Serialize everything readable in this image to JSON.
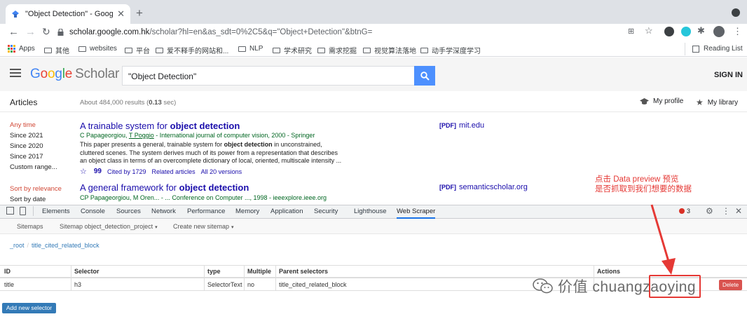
{
  "browser": {
    "tab_title": "\"Object Detection\" - Google Sc",
    "new_tab": "+",
    "url_host": "scholar.google.com.hk",
    "url_path": "/scholar?hl=en&as_sdt=0%2C5&q=\"Object+Detection\"&btnG=",
    "bookmarks": [
      "Apps",
      "其他",
      "websites",
      "平台",
      "爱不释手的网站和...",
      "NLP",
      "学术研究",
      "需求挖掘",
      "视觉算法落地",
      "动手学深度学习"
    ],
    "reading_list": "Reading List"
  },
  "scholar": {
    "logo_google": "Google",
    "logo_scholar": "Scholar",
    "search_value": "\"Object Detection\"",
    "sign_in": "SIGN IN",
    "articles": "Articles",
    "about_prefix": "About 484,000 results (",
    "about_time": "0.13",
    "about_suffix": " sec)",
    "my_profile": "My profile",
    "my_library": "My library",
    "sidebar_time": [
      "Any time",
      "Since 2021",
      "Since 2020",
      "Since 2017",
      "Custom range..."
    ],
    "sidebar_sort": [
      "Sort by relevance",
      "Sort by date"
    ],
    "results": [
      {
        "title_pre": "A trainable system for ",
        "title_bold": "object detection",
        "authors_a": "C Papageorgiou, ",
        "authors_link": "T Poggio",
        "authors_b": " - International journal of computer vision, 2000 - Springer",
        "snippet_1_pre": "This paper presents a general, trainable system for ",
        "snippet_1_bold": "object detection",
        "snippet_1_post": " in unconstrained,",
        "snippet_2": "cluttered scenes. The system derives much of its power from a representation that describes",
        "snippet_3": "an object class in terms of an overcomplete dictionary of local, oriented, multiscale intensity ...",
        "cited": "Cited by 1729",
        "related": "Related articles",
        "versions": "All 20 versions",
        "pdf_tag": "[PDF]",
        "pdf_host": "mit.edu"
      },
      {
        "title_pre": "A general framework for ",
        "title_bold": "object detection",
        "authors": "CP Papageorgiou, M Oren... - ... Conference on Computer ..., 1998 - ieeexplore.ieee.org",
        "pdf_tag": "[PDF]",
        "pdf_host": "semanticscholar.org"
      }
    ],
    "annotation_1": "点击 Data preview 预览",
    "annotation_2": "是否抓取到我们想要的数据"
  },
  "devtools": {
    "tabs": [
      "Elements",
      "Console",
      "Sources",
      "Network",
      "Performance",
      "Memory",
      "Application",
      "Security",
      "Lighthouse",
      "Web Scraper"
    ],
    "error_count": "3",
    "ws_nav": [
      "Sitemaps",
      "Sitemap object_detection_project",
      "Create new sitemap"
    ],
    "breadcrumb": [
      "_root",
      "title_cited_related_block"
    ],
    "table_headers": [
      "ID",
      "Selector",
      "type",
      "Multiple",
      "Parent selectors",
      "Actions"
    ],
    "rows": [
      {
        "id": "title",
        "selector": "h3",
        "type": "SelectorText",
        "multiple": "no",
        "parent": "title_cited_related_block"
      }
    ],
    "delete_label": "Delete",
    "add_selector": "Add new selector"
  },
  "watermark": "价值 chuangzaoying",
  "colors": {
    "accent_blue": "#4d90fe",
    "link": "#1a0dab",
    "green": "#006621",
    "red_annot": "#e53935",
    "delete": "#d9534f"
  }
}
